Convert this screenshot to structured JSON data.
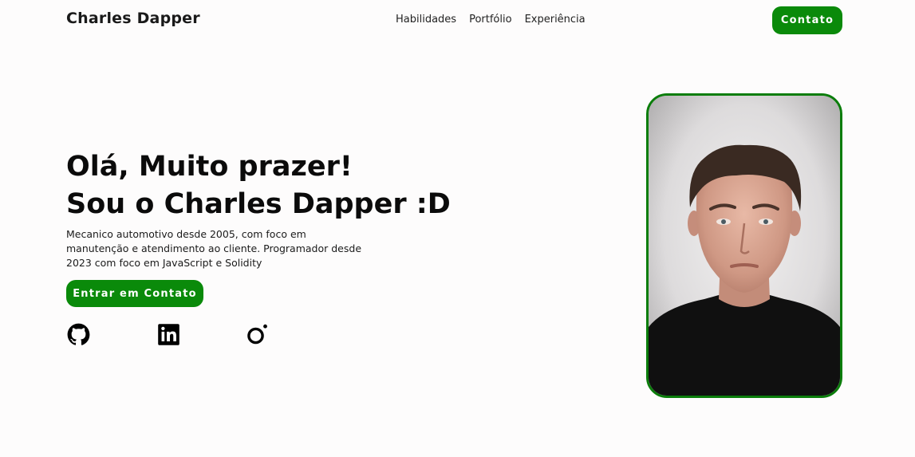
{
  "header": {
    "brand": "Charles Dapper",
    "nav": [
      {
        "label": "Habilidades"
      },
      {
        "label": "Portfólio"
      },
      {
        "label": "Experiência"
      }
    ],
    "contact_button": "Contato"
  },
  "hero": {
    "title_line1": "Olá, Muito prazer!",
    "title_line2": "Sou o Charles Dapper :D",
    "description": "Mecanico automotivo desde 2005, com foco em manutenção e atendimento ao cliente. Programador desde 2023 com foco em JavaScript e Solidity",
    "cta_button": "Entrar em Contato"
  },
  "socials": [
    {
      "icon": "github-icon"
    },
    {
      "icon": "linkedin-icon"
    },
    {
      "icon": "threads-icon"
    }
  ],
  "profile_photo": {
    "icon": "profile-photo"
  },
  "colors": {
    "accent": "#0a8a0a",
    "background": "#fdfcfc",
    "text": "#0b0b0b"
  }
}
